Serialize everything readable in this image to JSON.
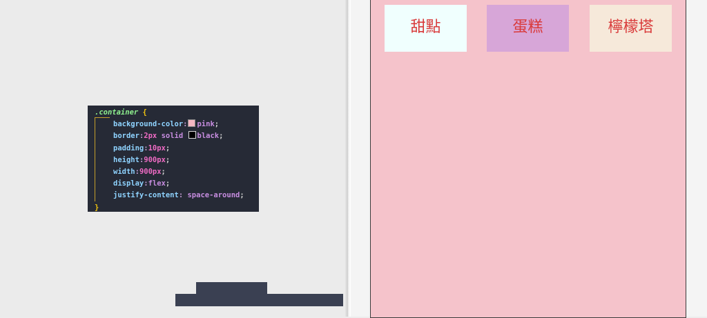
{
  "code": {
    "selector": ".container",
    "open_brace": "{",
    "close_brace": "}",
    "lines": [
      {
        "prop": "background-color",
        "value": "pink"
      },
      {
        "prop": "border",
        "num": "2px",
        "value": "solid",
        "value2": "black"
      },
      {
        "prop": "padding",
        "num": "10px"
      },
      {
        "prop": "height",
        "num": "900px"
      },
      {
        "prop": "width",
        "num": "900px"
      },
      {
        "prop": "display",
        "value": "flex"
      },
      {
        "prop": "justify-content",
        "value": "space-around"
      }
    ],
    "colors": {
      "pink_swatch": "#f4b6c2",
      "black_swatch": "#000000"
    }
  },
  "preview": {
    "items": [
      {
        "label": "甜點",
        "bg": "#f0fffe"
      },
      {
        "label": "蛋糕",
        "bg": "#d7a6d8"
      },
      {
        "label": "檸檬塔",
        "bg": "#f6e9da"
      }
    ],
    "container_bg": "#f5c3cb",
    "text_color": "#d93a3a"
  }
}
